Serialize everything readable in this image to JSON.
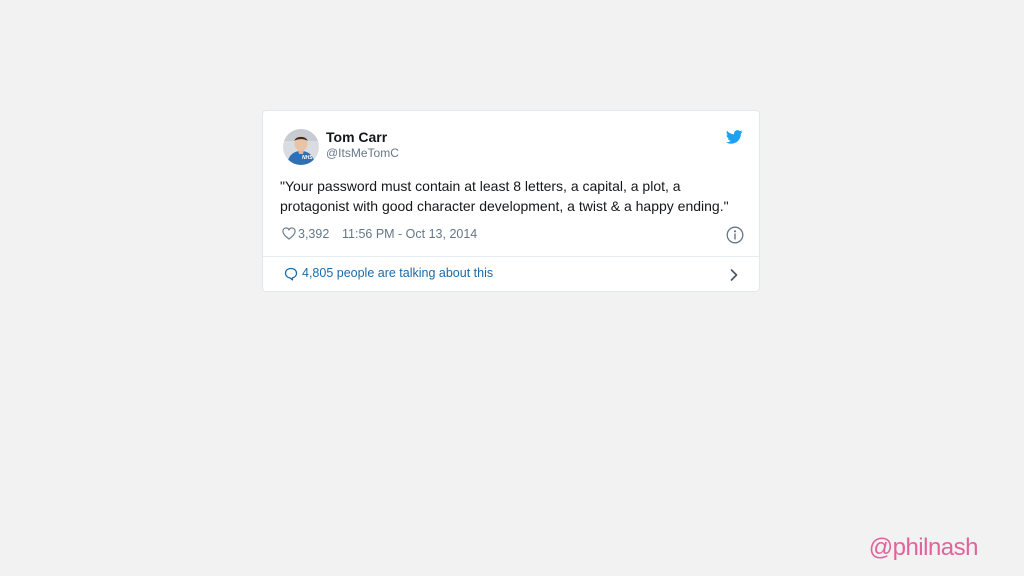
{
  "tweet": {
    "author_name": "Tom Carr",
    "author_handle": "@ItsMeTomC",
    "text": "\"Your password must contain at least 8 letters, a capital, a plot, a protagonist with good character development, a twist & a happy ending.\"",
    "like_count": "3,392",
    "timestamp": "11:56 PM - Oct 13, 2014",
    "conversation_label": "4,805 people are talking about this",
    "avatar_badge": "NHS"
  },
  "watermark": "@philnash",
  "icons": {
    "brand": "twitter-bird-icon",
    "like": "heart-icon",
    "info": "info-icon",
    "reply": "speech-bubble-icon",
    "chevron": "chevron-right-icon"
  },
  "colors": {
    "background": "#f2f2f2",
    "card": "#ffffff",
    "twitter_blue": "#1da1f2",
    "link_blue": "#1b6ba8",
    "watermark_pink": "#e0649b"
  }
}
